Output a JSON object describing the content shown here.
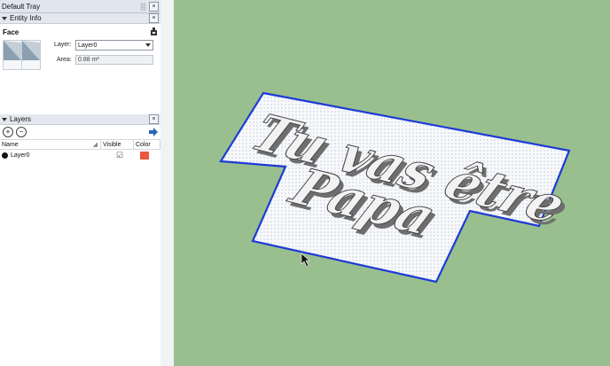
{
  "tray": {
    "title": "Default Tray",
    "pin_glyph": "░",
    "close_glyph": "×"
  },
  "entity_info": {
    "header": "Entity Info",
    "entity_type": "Face",
    "layer_label": "Layer:",
    "layer_value": "Layer0",
    "area_label": "Area:",
    "area_value": "0.88 m²"
  },
  "layers": {
    "header": "Layers",
    "columns": {
      "name": "Name",
      "visible": "Visible",
      "color": "Color"
    },
    "rows": [
      {
        "name": "Layer0",
        "visible": "☑",
        "color": "#e8573f"
      }
    ],
    "add_glyph": "+",
    "remove_glyph": "−"
  },
  "viewport": {
    "text_line1": "Tu vas être",
    "text_line2": "Papa",
    "colors": {
      "background": "#99bf8e",
      "plate_edge": "#1d3bd6",
      "letters": "#f2f2f2"
    }
  }
}
